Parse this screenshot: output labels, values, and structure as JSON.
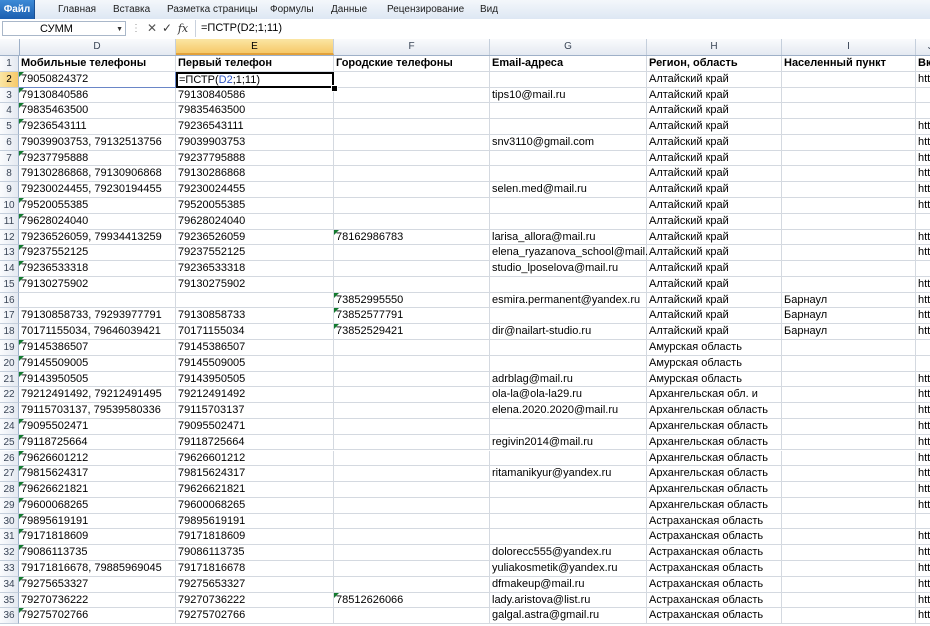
{
  "ribbon_tabs": [
    "Файл",
    "Главная",
    "Вставка",
    "Разметка страницы",
    "Формулы",
    "Данные",
    "Рецензирование",
    "Вид"
  ],
  "formula_bar": {
    "name_box": "СУММ",
    "name_box_icon": "chevron-down-icon",
    "cancel_icon": "cancel-icon",
    "enter_icon": "check-icon",
    "fx_label": "fx",
    "formula": "=ПСТР(D2;1;11)"
  },
  "columns": [
    "D",
    "E",
    "F",
    "G",
    "H",
    "I",
    "J"
  ],
  "active_cell": {
    "column": "E",
    "row": "2"
  },
  "headers": {
    "D": "Мобильные телефоны",
    "E": "Первый телефон",
    "F": "Городские телефоны",
    "G": "Email-адреса",
    "H": "Регион, область",
    "I": "Населенный пункт",
    "J": "Вк"
  },
  "editing": {
    "prefix": "=ПСТР(",
    "ref": "D2",
    "suffix": ";1;11)"
  },
  "rows": [
    {
      "n": "2",
      "D": "79050824372",
      "E": "",
      "F": "",
      "G": "",
      "H": "Алтайский край",
      "I": "",
      "J": "htt",
      "mark": true
    },
    {
      "n": "3",
      "D": "79130840586",
      "E": "79130840586",
      "F": "",
      "G": "tips10@mail.ru",
      "H": "Алтайский край",
      "I": "",
      "J": "",
      "mark": true
    },
    {
      "n": "4",
      "D": "79835463500",
      "E": "79835463500",
      "F": "",
      "G": "",
      "H": "Алтайский край",
      "I": "",
      "J": "",
      "mark": true
    },
    {
      "n": "5",
      "D": "79236543111",
      "E": "79236543111",
      "F": "",
      "G": "",
      "H": "Алтайский край",
      "I": "",
      "J": "htt",
      "mark": true
    },
    {
      "n": "6",
      "D": "79039903753, 79132513756",
      "E": "79039903753",
      "F": "",
      "G": "snv3110@gmail.com",
      "H": "Алтайский край",
      "I": "",
      "J": "htt",
      "mark": false
    },
    {
      "n": "7",
      "D": "79237795888",
      "E": "79237795888",
      "F": "",
      "G": "",
      "H": "Алтайский край",
      "I": "",
      "J": "htt",
      "mark": true
    },
    {
      "n": "8",
      "D": "79130286868, 79130906868",
      "E": "79130286868",
      "F": "",
      "G": "",
      "H": "Алтайский край",
      "I": "",
      "J": "htt",
      "mark": false
    },
    {
      "n": "9",
      "D": "79230024455, 79230194455",
      "E": "79230024455",
      "F": "",
      "G": "selen.med@mail.ru",
      "H": "Алтайский край",
      "I": "",
      "J": "htt",
      "mark": false
    },
    {
      "n": "10",
      "D": "79520055385",
      "E": "79520055385",
      "F": "",
      "G": "",
      "H": "Алтайский край",
      "I": "",
      "J": "htt",
      "mark": true
    },
    {
      "n": "11",
      "D": "79628024040",
      "E": "79628024040",
      "F": "",
      "G": "",
      "H": "Алтайский край",
      "I": "",
      "J": "",
      "mark": true
    },
    {
      "n": "12",
      "D": "79236526059, 79934413259",
      "E": "79236526059",
      "F": "78162986783",
      "G": "larisa_allora@mail.ru",
      "H": "Алтайский край",
      "I": "",
      "J": "htt",
      "mark": false
    },
    {
      "n": "13",
      "D": "79237552125",
      "E": "79237552125",
      "F": "",
      "G": "elena_ryazanova_school@mail.",
      "H": "Алтайский край",
      "I": "",
      "J": "htt",
      "mark": true
    },
    {
      "n": "14",
      "D": "79236533318",
      "E": "79236533318",
      "F": "",
      "G": "studio_lposelova@mail.ru",
      "H": "Алтайский край",
      "I": "",
      "J": "",
      "mark": true
    },
    {
      "n": "15",
      "D": "79130275902",
      "E": "79130275902",
      "F": "",
      "G": "",
      "H": "Алтайский край",
      "I": "",
      "J": "htt",
      "mark": true
    },
    {
      "n": "16",
      "D": "",
      "E": "",
      "F": "73852995550",
      "G": "esmira.permanent@yandex.ru",
      "H": "Алтайский край",
      "I": "Барнаул",
      "J": "htt",
      "mark": false
    },
    {
      "n": "17",
      "D": "79130858733, 79293977791",
      "E": "79130858733",
      "F": "73852577791",
      "G": "",
      "H": "Алтайский край",
      "I": "Барнаул",
      "J": "htt",
      "mark": false
    },
    {
      "n": "18",
      "D": "70171155034, 79646039421",
      "E": "70171155034",
      "F": "73852529421",
      "G": "dir@nailart-studio.ru",
      "H": "Алтайский край",
      "I": "Барнаул",
      "J": "htt",
      "mark": false
    },
    {
      "n": "19",
      "D": "79145386507",
      "E": "79145386507",
      "F": "",
      "G": "",
      "H": "Амурская область",
      "I": "",
      "J": "",
      "mark": true
    },
    {
      "n": "20",
      "D": "79145509005",
      "E": "79145509005",
      "F": "",
      "G": "",
      "H": "Амурская область",
      "I": "",
      "J": "",
      "mark": true
    },
    {
      "n": "21",
      "D": "79143950505",
      "E": "79143950505",
      "F": "",
      "G": "adrblag@mail.ru",
      "H": "Амурская область",
      "I": "",
      "J": "htt",
      "mark": true
    },
    {
      "n": "22",
      "D": "79212491492, 79212491495",
      "E": "79212491492",
      "F": "",
      "G": "ola-la@ola-la29.ru",
      "H": "Архангельская обл. и",
      "I": "",
      "J": "htt",
      "mark": false
    },
    {
      "n": "23",
      "D": "79115703137, 79539580336",
      "E": "79115703137",
      "F": "",
      "G": "elena.2020.2020@mail.ru",
      "H": "Архангельская область",
      "I": "",
      "J": "htt",
      "mark": false
    },
    {
      "n": "24",
      "D": "79095502471",
      "E": "79095502471",
      "F": "",
      "G": "",
      "H": "Архангельская область",
      "I": "",
      "J": "htt",
      "mark": true
    },
    {
      "n": "25",
      "D": "79118725664",
      "E": "79118725664",
      "F": "",
      "G": "regivin2014@mail.ru",
      "H": "Архангельская область",
      "I": "",
      "J": "htt",
      "mark": true
    },
    {
      "n": "26",
      "D": "79626601212",
      "E": "79626601212",
      "F": "",
      "G": "",
      "H": "Архангельская область",
      "I": "",
      "J": "htt",
      "mark": true
    },
    {
      "n": "27",
      "D": "79815624317",
      "E": "79815624317",
      "F": "",
      "G": "ritamanikyur@yandex.ru",
      "H": "Архангельская область",
      "I": "",
      "J": "htt",
      "mark": true
    },
    {
      "n": "28",
      "D": "79626621821",
      "E": "79626621821",
      "F": "",
      "G": "",
      "H": "Архангельская область",
      "I": "",
      "J": "htt",
      "mark": true
    },
    {
      "n": "29",
      "D": "79600068265",
      "E": "79600068265",
      "F": "",
      "G": "",
      "H": "Архангельская область",
      "I": "",
      "J": "htt",
      "mark": true
    },
    {
      "n": "30",
      "D": "79895619191",
      "E": "79895619191",
      "F": "",
      "G": "",
      "H": "Астраханская область",
      "I": "",
      "J": "",
      "mark": true
    },
    {
      "n": "31",
      "D": "79171818609",
      "E": "79171818609",
      "F": "",
      "G": "",
      "H": "Астраханская область",
      "I": "",
      "J": "htt",
      "mark": true
    },
    {
      "n": "32",
      "D": "79086113735",
      "E": "79086113735",
      "F": "",
      "G": "dolorecc555@yandex.ru",
      "H": "Астраханская область",
      "I": "",
      "J": "htt",
      "mark": true
    },
    {
      "n": "33",
      "D": "79171816678, 79885969045",
      "E": "79171816678",
      "F": "",
      "G": "yuliakosmetik@yandex.ru",
      "H": "Астраханская область",
      "I": "",
      "J": "htt",
      "mark": false
    },
    {
      "n": "34",
      "D": "79275653327",
      "E": "79275653327",
      "F": "",
      "G": "dfmakeup@mail.ru",
      "H": "Астраханская область",
      "I": "",
      "J": "htt",
      "mark": true
    },
    {
      "n": "35",
      "D": "79270736222",
      "E": "79270736222",
      "F": "78512626066",
      "G": "lady.aristova@list.ru",
      "H": "Астраханская область",
      "I": "",
      "J": "htt",
      "mark": false
    },
    {
      "n": "36",
      "D": "79275702766",
      "E": "79275702766",
      "F": "",
      "G": "galgal.astra@gmail.ru",
      "H": "Астраханская область",
      "I": "",
      "J": "htt",
      "mark": true
    }
  ]
}
